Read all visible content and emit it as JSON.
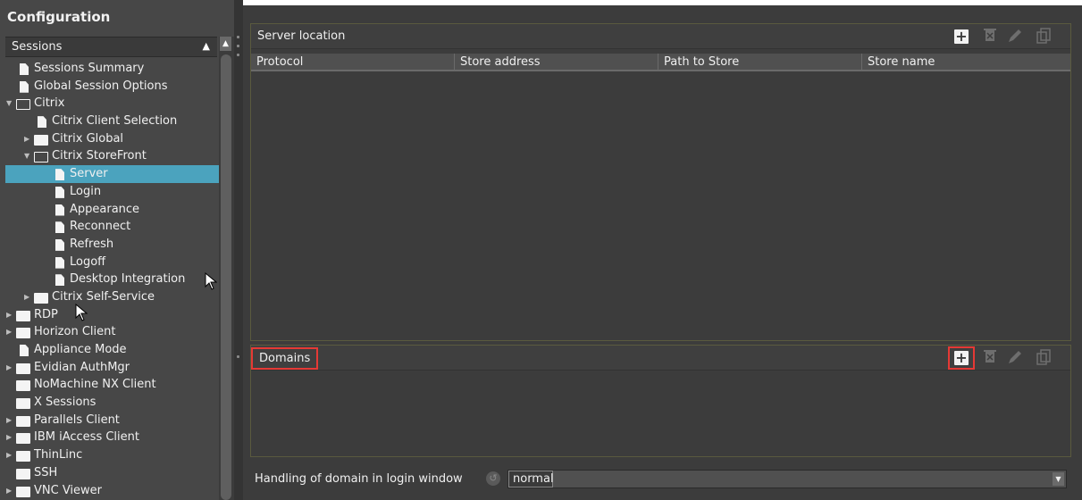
{
  "sidebar": {
    "title": "Configuration",
    "section": {
      "label": "Sessions",
      "collapse_arrow": "triangle-up-icon"
    },
    "tree": [
      {
        "label": "Sessions Summary",
        "icon": "file-icon",
        "level": 0
      },
      {
        "label": "Global Session Options",
        "icon": "file-icon",
        "level": 0
      },
      {
        "label": "Citrix",
        "icon": "folder-open-icon",
        "level": 0,
        "expanded": true
      },
      {
        "label": "Citrix Client Selection",
        "icon": "file-icon",
        "level": 1
      },
      {
        "label": "Citrix Global",
        "icon": "folder-icon",
        "level": 1,
        "expanded": false
      },
      {
        "label": "Citrix StoreFront",
        "icon": "folder-open-icon",
        "level": 1,
        "expanded": true
      },
      {
        "label": "Server",
        "icon": "file-icon",
        "level": 2,
        "selected": true
      },
      {
        "label": "Login",
        "icon": "file-icon",
        "level": 2
      },
      {
        "label": "Appearance",
        "icon": "file-icon",
        "level": 2
      },
      {
        "label": "Reconnect",
        "icon": "file-icon",
        "level": 2
      },
      {
        "label": "Refresh",
        "icon": "file-icon",
        "level": 2
      },
      {
        "label": "Logoff",
        "icon": "file-icon",
        "level": 2
      },
      {
        "label": "Desktop Integration",
        "icon": "file-icon",
        "level": 2
      },
      {
        "label": "Citrix Self-Service",
        "icon": "folder-icon",
        "level": 1,
        "expanded": false
      },
      {
        "label": "RDP",
        "icon": "folder-icon",
        "level": 0,
        "expanded": false
      },
      {
        "label": "Horizon Client",
        "icon": "folder-icon",
        "level": 0,
        "expanded": false
      },
      {
        "label": "Appliance Mode",
        "icon": "file-icon",
        "level": 0
      },
      {
        "label": "Evidian AuthMgr",
        "icon": "folder-icon",
        "level": 0,
        "expanded": false
      },
      {
        "label": "NoMachine NX Client",
        "icon": "folder-icon",
        "level": 0
      },
      {
        "label": "X Sessions",
        "icon": "folder-icon",
        "level": 0
      },
      {
        "label": "Parallels Client",
        "icon": "folder-icon",
        "level": 0,
        "expanded": false
      },
      {
        "label": "IBM iAccess Client",
        "icon": "folder-icon",
        "level": 0,
        "expanded": false
      },
      {
        "label": "ThinLinc",
        "icon": "folder-icon",
        "level": 0,
        "expanded": false
      },
      {
        "label": "SSH",
        "icon": "folder-icon",
        "level": 0
      },
      {
        "label": "VNC Viewer",
        "icon": "folder-icon",
        "level": 0,
        "expanded": false
      }
    ],
    "selected_color": "#4ba3be"
  },
  "server_panel": {
    "title": "Server location",
    "columns": [
      "Protocol",
      "Store address",
      "Path to Store",
      "Store name"
    ],
    "rows": [],
    "toolbar": [
      "add-icon",
      "delete-icon",
      "edit-icon",
      "copy-icon"
    ]
  },
  "domains_panel": {
    "title": "Domains",
    "rows": [],
    "toolbar": [
      "add-icon",
      "delete-icon",
      "edit-icon",
      "copy-icon"
    ]
  },
  "domain_handling": {
    "label": "Handling of domain in login window",
    "value": "normal"
  },
  "colors": {
    "highlight_box": "#e53935",
    "background": "#3c3c3c"
  }
}
